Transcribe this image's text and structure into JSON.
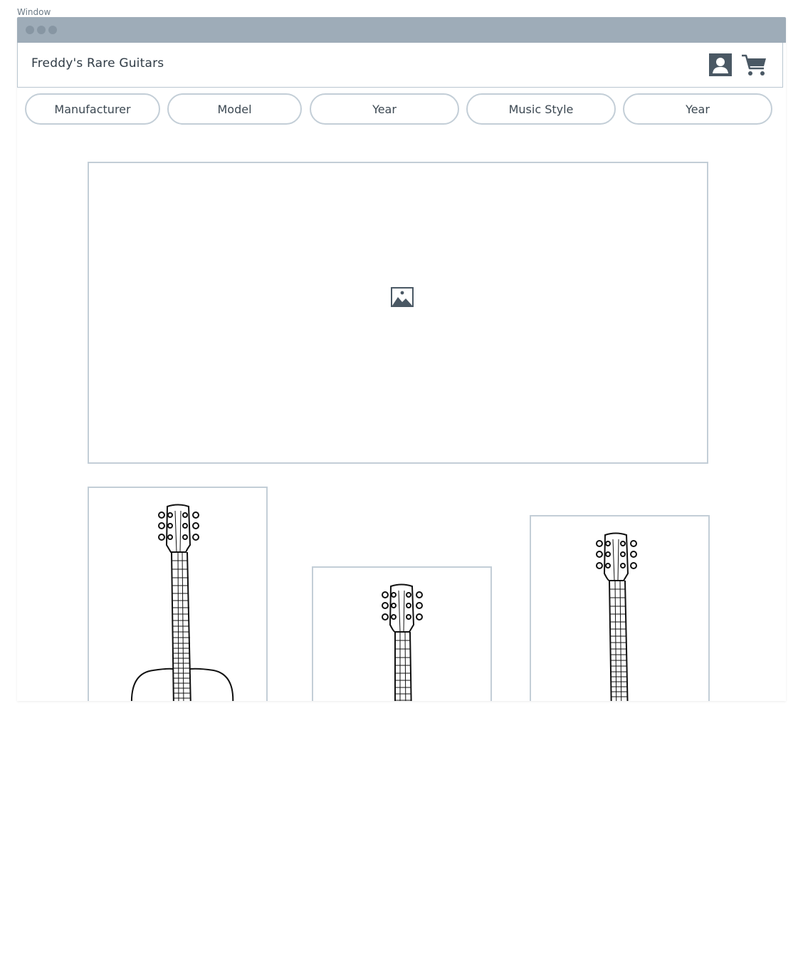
{
  "window": {
    "caption": "Window"
  },
  "header": {
    "title": "Freddy's Rare Guitars",
    "icons": [
      "user-icon",
      "cart-icon"
    ]
  },
  "filters": [
    {
      "label": "Manufacturer"
    },
    {
      "label": "Model"
    },
    {
      "label": "Year"
    },
    {
      "label": "Music Style"
    },
    {
      "label": "Year"
    }
  ],
  "hero": {
    "icon": "image-placeholder-icon"
  },
  "products": [
    {
      "icon": "guitar-icon"
    },
    {
      "icon": "guitar-icon"
    },
    {
      "icon": "guitar-icon"
    }
  ],
  "colors": {
    "titlebar": "#9eacb8",
    "border": "#c3ced7",
    "icon_dark": "#4a5864",
    "text": "#3c4852"
  }
}
